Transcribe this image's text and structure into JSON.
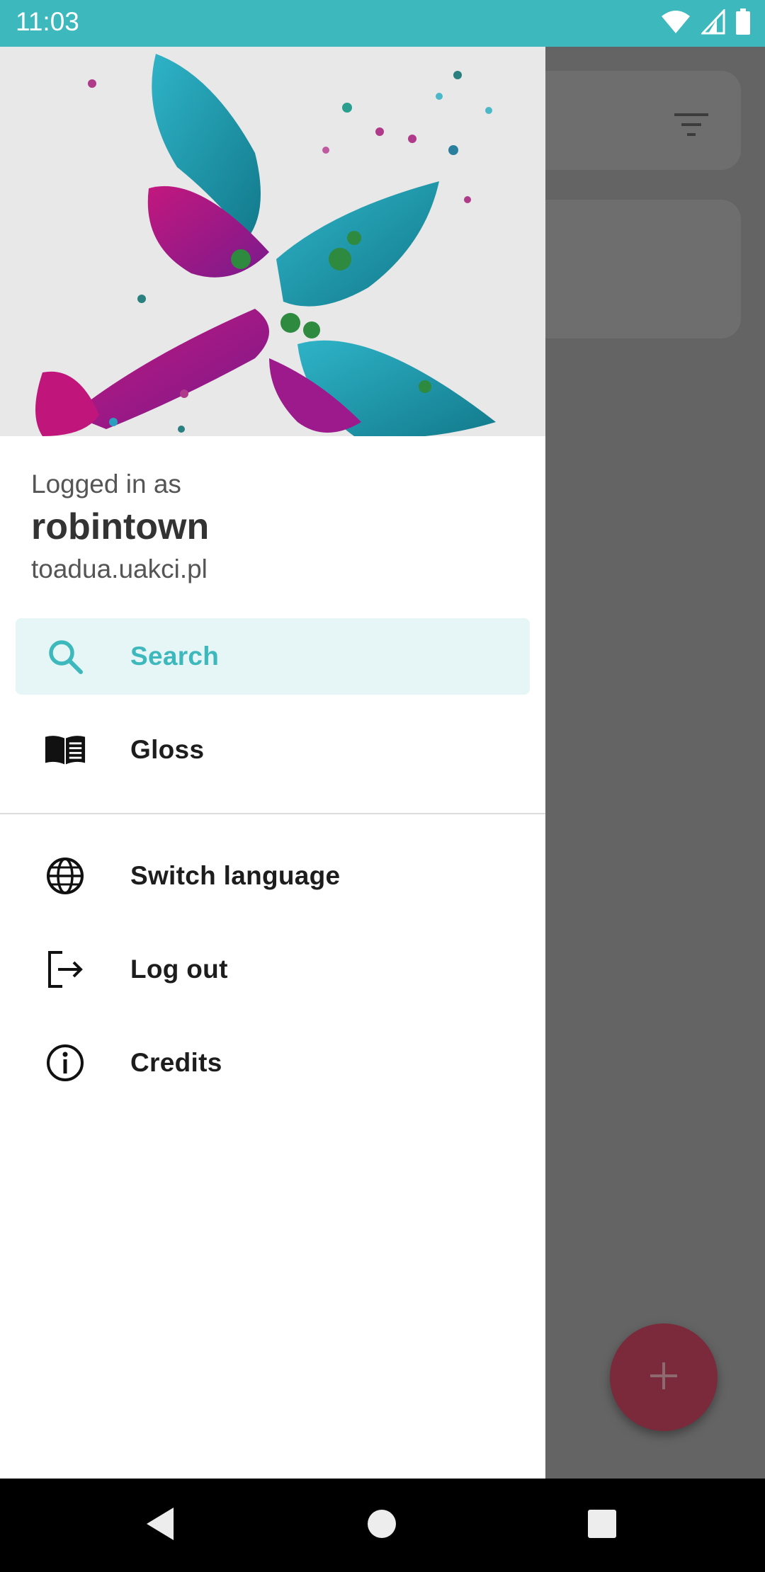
{
  "status_bar": {
    "time": "11:03",
    "icons": [
      "wifi-icon",
      "cell-signal-icon",
      "battery-icon"
    ]
  },
  "drawer": {
    "account": {
      "logged_in_label": "Logged in as",
      "username": "robintown",
      "server": "toadua.uakci.pl"
    },
    "items": [
      {
        "label": "Search",
        "icon": "search-icon",
        "active": true
      },
      {
        "label": "Gloss",
        "icon": "book-icon",
        "active": false
      },
      {
        "label": "Switch language",
        "icon": "globe-icon",
        "active": false
      },
      {
        "label": "Log out",
        "icon": "logout-icon",
        "active": false
      },
      {
        "label": "Credits",
        "icon": "info-icon",
        "active": false
      }
    ]
  },
  "background_app": {
    "filter_icon": "filter-icon",
    "fab_icon": "plus-icon"
  },
  "navigation_bar": {
    "buttons": [
      "back-icon",
      "home-icon",
      "recents-icon"
    ]
  },
  "colors": {
    "accent": "#3db9bd",
    "active_background": "#e6f5f5",
    "fab": "#7b2a3b",
    "scrim": "#646464"
  }
}
